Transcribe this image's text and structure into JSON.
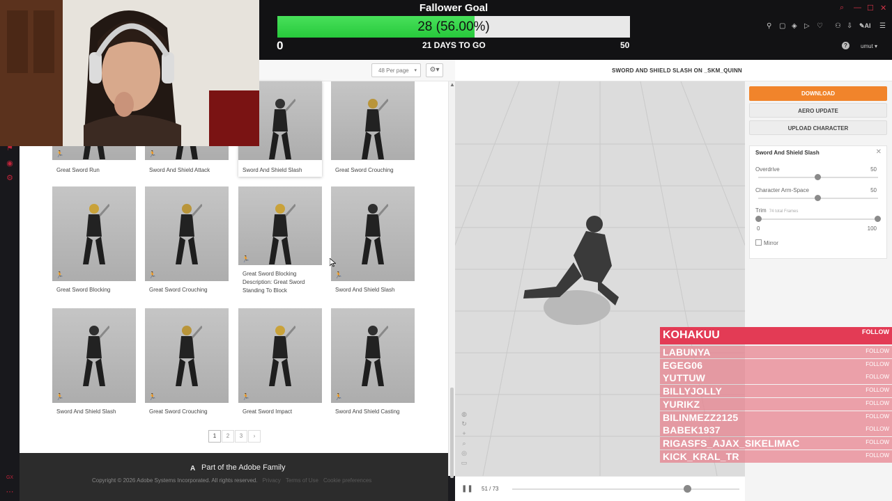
{
  "goal": {
    "title": "Fallower Goal",
    "progress_text": "28 (56.00%)",
    "progress": 0.56,
    "min": "0",
    "days_to_go": "21 DAYS TO GO",
    "max": "50"
  },
  "browser": {
    "user": "umut",
    "ai_label": "AI",
    "help": "?"
  },
  "left_sidebar": {
    "icons": [
      "gift-icon",
      "contacts-icon",
      "settings-icon",
      "gx-icon",
      "more-icon"
    ],
    "gx_label": "GX"
  },
  "toolbar": {
    "per_page": "48 Per page"
  },
  "cards": [
    {
      "label": "Great Sword Run"
    },
    {
      "label": "Sword And Shield Attack"
    },
    {
      "label": "Sword And Shield Slash"
    },
    {
      "label": "Great Sword Crouching"
    },
    {
      "label": "Great Sword Blocking"
    },
    {
      "label": "Great Sword Crouching"
    },
    {
      "label": "Great Sword Blocking",
      "desc": "Description: Great Sword Standing To Block"
    },
    {
      "label": "Sword And Shield Slash"
    },
    {
      "label": "Sword And Shield Slash"
    },
    {
      "label": "Great Sword Crouching"
    },
    {
      "label": "Great Sword Impact"
    },
    {
      "label": "Sword And Shield Casting"
    }
  ],
  "pagination": {
    "pages": [
      "1",
      "2",
      "3"
    ],
    "next": "›"
  },
  "footer": {
    "adobe": "Part of the Adobe Family",
    "copyright": "Copyright © 2026 Adobe Systems Incorporated. All rights reserved.",
    "links": [
      "Privacy",
      "Terms of Use",
      "Cookie preferences"
    ]
  },
  "viewer": {
    "title": "SWORD AND SHIELD SLASH ON _SKM_QUINN",
    "frame": "51 / 73",
    "frame_progress": 0.7
  },
  "actions": {
    "download": "DOWNLOAD",
    "aero": "AERO UPDATE",
    "upload": "UPLOAD CHARACTER"
  },
  "settings": {
    "title": "Sword And Shield Slash",
    "overdrive": {
      "label": "Overdrive",
      "value": "50"
    },
    "arm_space": {
      "label": "Character Arm-Space",
      "value": "50"
    },
    "trim": {
      "label": "Trim",
      "sub": "74 total Frames",
      "min": "0",
      "max": "100"
    },
    "mirror": "Mirror"
  },
  "followers": {
    "top": {
      "name": "KOHAKUU",
      "action": "FOLLOW"
    },
    "rows": [
      {
        "name": "LABUNYA",
        "action": "FOLLOW"
      },
      {
        "name": "EGEG06",
        "action": "FOLLOW"
      },
      {
        "name": "YUTTUW",
        "action": "FOLLOW"
      },
      {
        "name": "BILLYJOLLY",
        "action": "FOLLOW"
      },
      {
        "name": "YURIKZ",
        "action": "FOLLOW"
      },
      {
        "name": "BILINMEZZ2125",
        "action": "FOLLOW"
      },
      {
        "name": "BABEK1937",
        "action": "FOLLOW"
      },
      {
        "name": "RIGASFS_AJAX_SIKELIMAC",
        "action": "FOLLOW"
      },
      {
        "name": "KICK_KRAL_TR",
        "action": "FOLLOW"
      }
    ]
  }
}
